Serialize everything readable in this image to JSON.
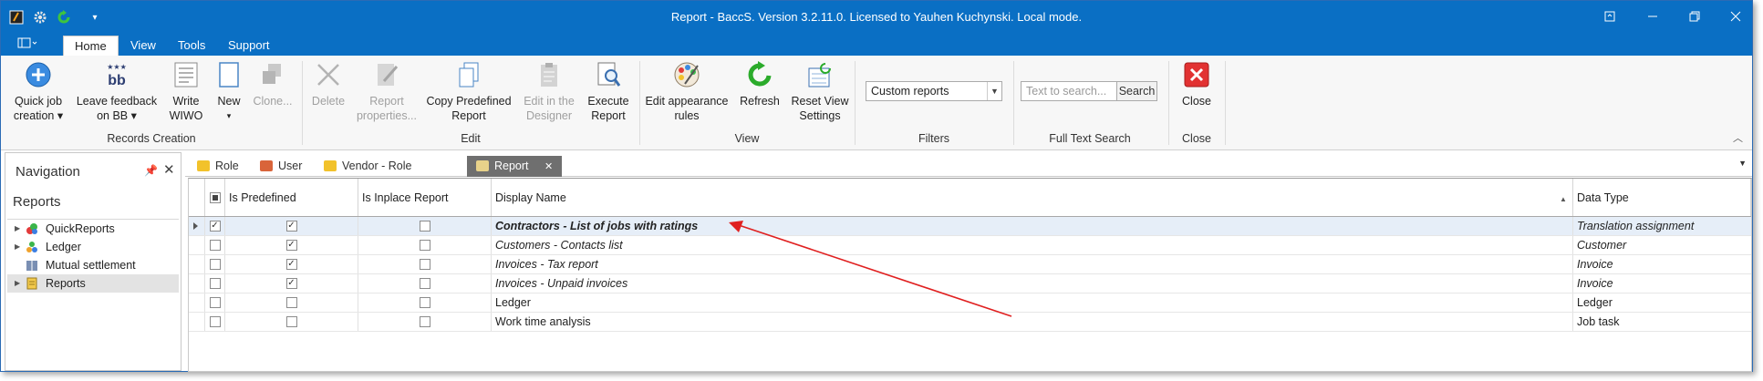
{
  "window": {
    "title": "Report - BaccS. Version 3.2.11.0. Licensed to Yauhen Kuchynski. Local mode.",
    "accent_color": "#0a6fc4"
  },
  "ribbon_tabs": [
    {
      "label": "Home",
      "active": true
    },
    {
      "label": "View"
    },
    {
      "label": "Tools"
    },
    {
      "label": "Support"
    }
  ],
  "ribbon": {
    "buttons": {
      "quick_job": "Quick job creation ▾",
      "leave_feedback": "Leave feedback on BB ▾",
      "write_wiwo": "Write WIWO",
      "new": "New",
      "clone": "Clone...",
      "delete": "Delete",
      "report_properties": "Report properties...",
      "copy_predefined": "Copy Predefined Report",
      "edit_in_designer": "Edit in the Designer",
      "execute_report": "Execute Report",
      "edit_appearance": "Edit appearance rules",
      "refresh": "Refresh",
      "reset_view": "Reset View Settings",
      "close": "Close"
    },
    "groups": {
      "records_creation": "Records Creation",
      "edit": "Edit",
      "view": "View",
      "filters": "Filters",
      "full_text_search": "Full Text Search",
      "close": "Close"
    },
    "filter_combo_value": "Custom reports",
    "search_placeholder": "Text to search...",
    "search_button": "Search"
  },
  "navigation": {
    "title": "Navigation",
    "section": "Reports",
    "items": [
      {
        "label": "QuickReports",
        "expandable": true,
        "icon": "quickreports-icon"
      },
      {
        "label": "Ledger",
        "expandable": true,
        "icon": "ledger-icon"
      },
      {
        "label": "Mutual settlement",
        "expandable": false,
        "icon": "book-icon"
      },
      {
        "label": "Reports",
        "expandable": true,
        "icon": "reports-icon",
        "selected": true
      }
    ]
  },
  "doc_tabs": [
    {
      "label": "Role",
      "icon": "role-icon"
    },
    {
      "label": "User",
      "icon": "user-icon"
    },
    {
      "label": "Vendor - Role",
      "icon": "vendor-role-icon"
    },
    {
      "label": "Report",
      "icon": "report-icon",
      "active": true
    }
  ],
  "grid": {
    "columns": [
      "Is Predefined",
      "Is Inplace Report",
      "Display Name",
      "Data Type"
    ],
    "rows": [
      {
        "selected": true,
        "predefined": true,
        "inplace": false,
        "name": "Contractors - List of jobs with ratings",
        "type": "Translation assignment",
        "italic": true,
        "bold": true,
        "current": true
      },
      {
        "selected": false,
        "predefined": true,
        "inplace": false,
        "name": "Customers - Contacts list",
        "type": "Customer",
        "italic": true
      },
      {
        "selected": false,
        "predefined": true,
        "inplace": false,
        "name": "Invoices - Tax report",
        "type": "Invoice",
        "italic": true
      },
      {
        "selected": false,
        "predefined": true,
        "inplace": false,
        "name": "Invoices - Unpaid invoices",
        "type": "Invoice",
        "italic": true
      },
      {
        "selected": false,
        "predefined": false,
        "inplace": false,
        "name": "Ledger",
        "type": "Ledger",
        "italic": false
      },
      {
        "selected": false,
        "predefined": false,
        "inplace": false,
        "name": "Work time analysis",
        "type": "Job task",
        "italic": false
      }
    ]
  }
}
